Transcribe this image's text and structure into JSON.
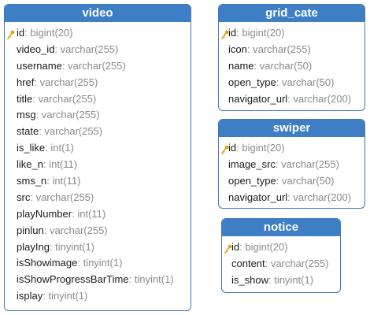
{
  "tables": [
    {
      "id": "video",
      "title": "video",
      "columns": [
        {
          "name": "id",
          "type": "bigint(20)",
          "pk": true
        },
        {
          "name": "video_id",
          "type": "varchar(255)"
        },
        {
          "name": "username",
          "type": "varchar(255)"
        },
        {
          "name": "href",
          "type": "varchar(255)"
        },
        {
          "name": "title",
          "type": "varchar(255)"
        },
        {
          "name": "msg",
          "type": "varchar(255)"
        },
        {
          "name": "state",
          "type": "varchar(255)"
        },
        {
          "name": "is_like",
          "type": "int(1)"
        },
        {
          "name": "like_n",
          "type": "int(11)"
        },
        {
          "name": "sms_n",
          "type": "int(11)"
        },
        {
          "name": "src",
          "type": "varchar(255)"
        },
        {
          "name": "playNumber",
          "type": "int(11)"
        },
        {
          "name": "pinlun",
          "type": "varchar(255)"
        },
        {
          "name": "playIng",
          "type": "tinyint(1)"
        },
        {
          "name": "isShowimage",
          "type": "tinyint(1)"
        },
        {
          "name": "isShowProgressBarTime",
          "type": "tinyint(1)"
        },
        {
          "name": "isplay",
          "type": "tinyint(1)"
        }
      ]
    },
    {
      "id": "grid_cate",
      "title": "grid_cate",
      "columns": [
        {
          "name": "id",
          "type": "bigint(20)",
          "pk": true
        },
        {
          "name": "icon",
          "type": "varchar(255)"
        },
        {
          "name": "name",
          "type": "varchar(50)"
        },
        {
          "name": "open_type",
          "type": "varchar(50)"
        },
        {
          "name": "navigator_url",
          "type": "varchar(200)"
        }
      ]
    },
    {
      "id": "swiper",
      "title": "swiper",
      "columns": [
        {
          "name": "id",
          "type": "bigint(20)",
          "pk": true
        },
        {
          "name": "image_src",
          "type": "varchar(255)"
        },
        {
          "name": "open_type",
          "type": "varchar(50)"
        },
        {
          "name": "navigator_url",
          "type": "varchar(200)"
        }
      ]
    },
    {
      "id": "notice",
      "title": "notice",
      "columns": [
        {
          "name": "id",
          "type": "bigint(20)",
          "pk": true
        },
        {
          "name": "content",
          "type": "varchar(255)"
        },
        {
          "name": "is_show",
          "type": "tinyint(1)"
        }
      ]
    }
  ],
  "icons": {
    "primary_key": "key-icon"
  },
  "colors": {
    "header_bg": "#3d7ec4",
    "border": "#3d79b8",
    "header_text": "#ffffff",
    "column_name": "#1a1a1a",
    "column_type": "#8a8a8a",
    "key": "#e0a820"
  }
}
